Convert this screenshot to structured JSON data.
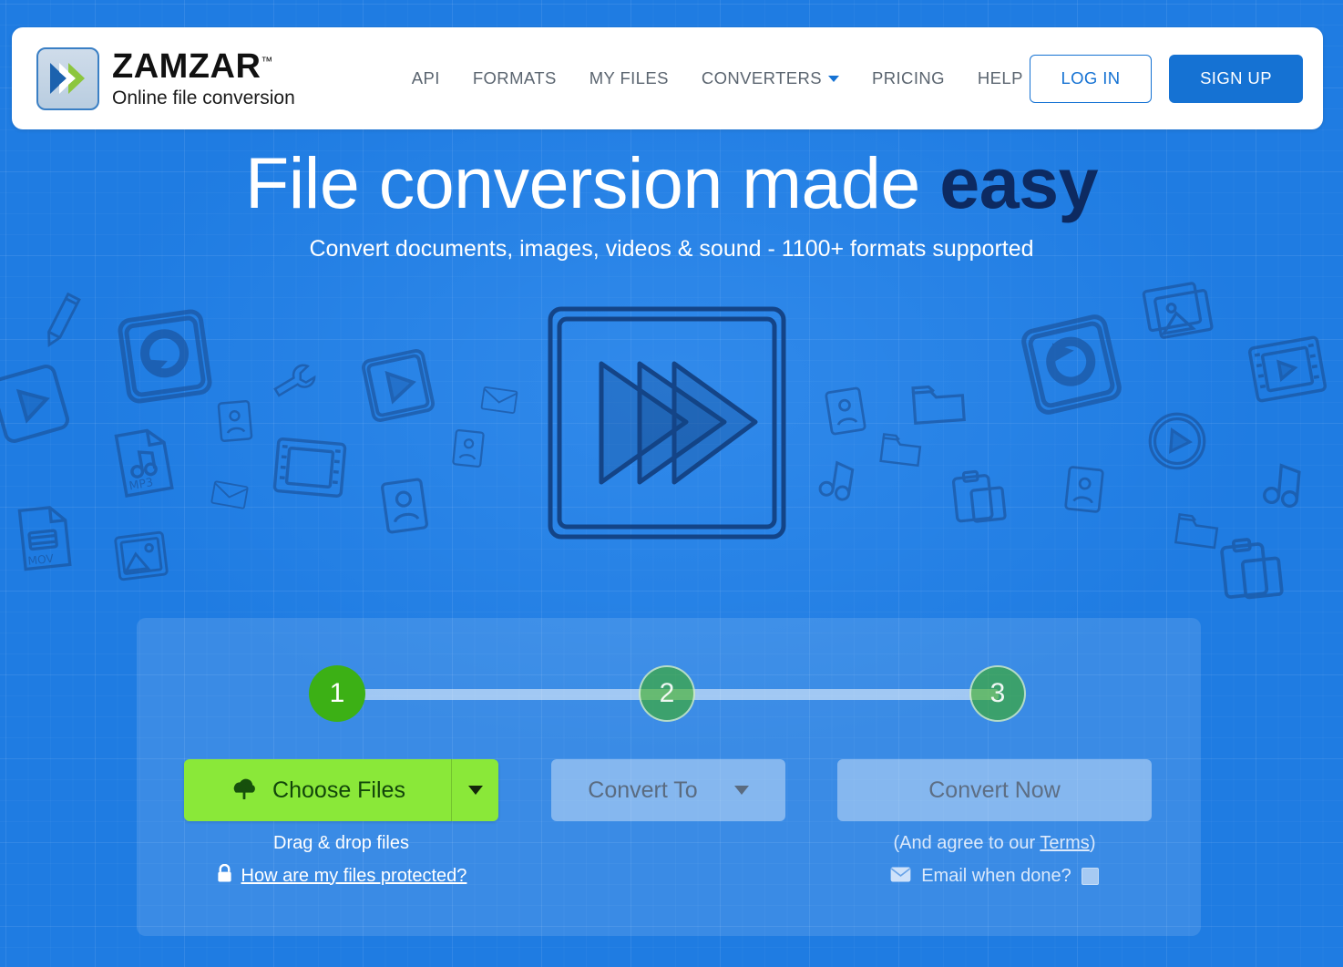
{
  "brand": {
    "name": "ZAMZAR",
    "tm": "™",
    "tagline": "Online file conversion",
    "logo_icon": "double-chevron-icon"
  },
  "nav": {
    "items": [
      {
        "label": "API",
        "has_caret": false
      },
      {
        "label": "FORMATS",
        "has_caret": false
      },
      {
        "label": "MY FILES",
        "has_caret": false
      },
      {
        "label": "CONVERTERS",
        "has_caret": true
      },
      {
        "label": "PRICING",
        "has_caret": false
      },
      {
        "label": "HELP",
        "has_caret": false
      }
    ],
    "login_label": "LOG IN",
    "signup_label": "SIGN UP"
  },
  "hero": {
    "title_main": "File conversion made ",
    "title_accent": "easy",
    "subtitle": "Convert documents, images, videos & sound - 1100+ formats supported",
    "illustration_icon": "fast-forward-sketch-icon"
  },
  "converter": {
    "steps": [
      {
        "number": "1",
        "state": "active"
      },
      {
        "number": "2",
        "state": "inactive"
      },
      {
        "number": "3",
        "state": "inactive"
      }
    ],
    "choose_files_label": "Choose Files",
    "choose_files_icon": "cloud-upload-icon",
    "convert_to_label": "Convert To",
    "convert_now_label": "Convert Now",
    "drag_drop_text": "Drag & drop files",
    "protected_link_label": "How are my files protected?",
    "protected_icon": "lock-icon",
    "terms_prefix": "(And agree to our ",
    "terms_link_label": "Terms",
    "terms_suffix": ")",
    "email_when_done_label": "Email when done?",
    "email_icon": "envelope-icon",
    "email_checkbox_checked": false
  },
  "colors": {
    "page_background": "#1f7ce2",
    "brand_blue": "#1572d3",
    "accent_green": "#8ae839",
    "step_active_green": "#3cb015",
    "headline_accent": "#0d2a61",
    "header_white": "#ffffff"
  },
  "background_icons": [
    "pencil-icon",
    "refresh-square-icon",
    "play-square-icon",
    "mp3-file-icon",
    "mov-file-icon",
    "envelope-icon",
    "image-file-icon",
    "wrench-icon",
    "film-strip-icon",
    "contact-card-icon",
    "photos-icon",
    "play-circle-icon",
    "music-note-icon",
    "folder-icon",
    "clipboard-icon",
    "document-icon"
  ]
}
